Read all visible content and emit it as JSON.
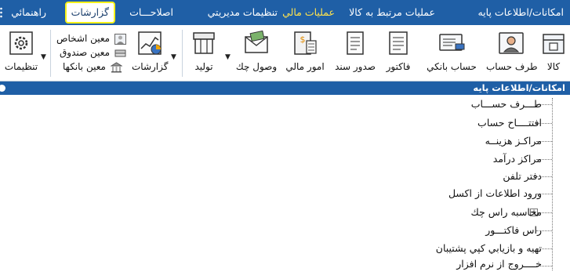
{
  "menu": {
    "items": [
      {
        "label": "امکانات/اطلاعات پايه"
      },
      {
        "label": "عمليات مرتبط به کالا"
      },
      {
        "label": "عمليات مالي"
      },
      {
        "label": "تنظيمات مديريتي"
      },
      {
        "label": "اصلاحـــات"
      },
      {
        "label": "گزارشات"
      },
      {
        "label": "راهنمائي"
      }
    ]
  },
  "toolbar": {
    "kala": "کالا",
    "taraf_hesab": "طرف حساب",
    "hesab_banki": "حساب بانکي",
    "factor": "فاکتور",
    "sodoor_sanad": "صدور سند",
    "omoor_mali": "امور مالي",
    "vosool_chek": "وصول چك",
    "tolid": "توليد",
    "gozareshat": "گزارشات",
    "moein_ashkhas": "معين اشخاص",
    "moein_sandogh": "معين صندوق",
    "moein_bankha": "معين بانکها",
    "tanzimat": "تنظيمات"
  },
  "section": {
    "title": "امکانات/اطلاعات پايه"
  },
  "tree": {
    "items": [
      {
        "label": "طـــرف حســـاب"
      },
      {
        "label": "افتتــــاح حساب"
      },
      {
        "label": "مراكـز هزينــه"
      },
      {
        "label": "مراكز درآمد"
      },
      {
        "label": "دفتر تلفن"
      },
      {
        "label": "ورود اطلاعات از اکسل"
      },
      {
        "label": "محاسبه راس چك"
      },
      {
        "label": "راس فاكتـــور"
      },
      {
        "label": "تهيه و بازيابي كپي پشتيبان"
      },
      {
        "label": "خــــروج از نرم افزار"
      }
    ]
  }
}
